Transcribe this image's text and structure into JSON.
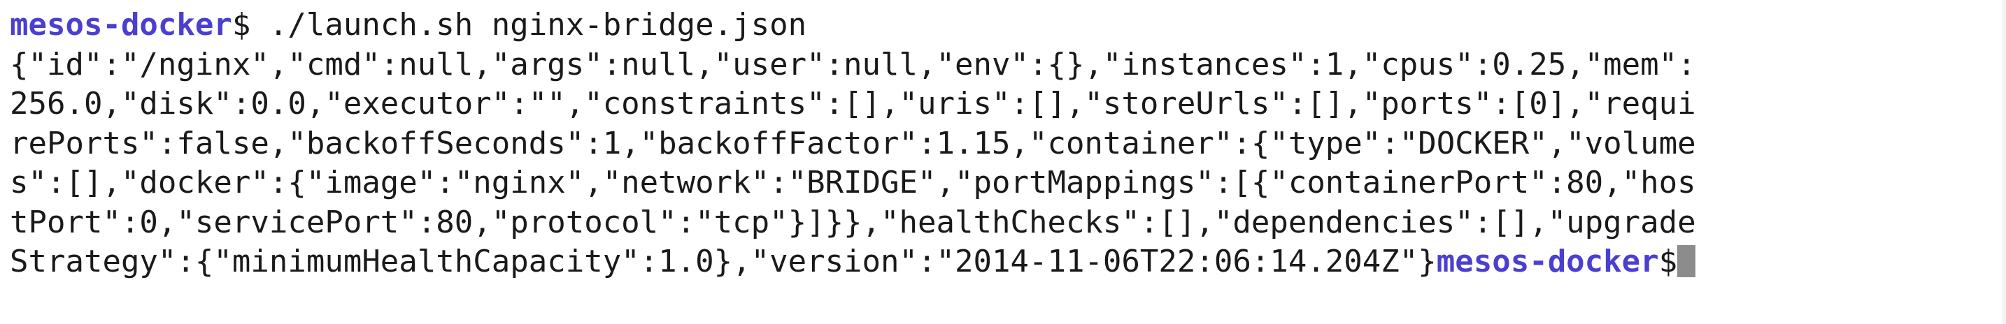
{
  "colors": {
    "prompt": "#4a3fd0",
    "text": "#1a1a1a",
    "cursor": "#8c8c8c",
    "background": "#ffffff"
  },
  "terminal": {
    "prompt_label": "mesos-docker",
    "prompt_symbol": "$",
    "command": " ./launch.sh nginx-bridge.json",
    "output_lines": [
      "{\"id\":\"/nginx\",\"cmd\":null,\"args\":null,\"user\":null,\"env\":{},\"instances\":1,\"cpus\":0.25,\"mem\":",
      "256.0,\"disk\":0.0,\"executor\":\"\",\"constraints\":[],\"uris\":[],\"storeUrls\":[],\"ports\":[0],\"requi",
      "rePorts\":false,\"backoffSeconds\":1,\"backoffFactor\":1.15,\"container\":{\"type\":\"DOCKER\",\"volume",
      "s\":[],\"docker\":{\"image\":\"nginx\",\"network\":\"BRIDGE\",\"portMappings\":[{\"containerPort\":80,\"hos",
      "tPort\":0,\"servicePort\":80,\"protocol\":\"tcp\"}]}},\"healthChecks\":[],\"dependencies\":[],\"upgrade"
    ],
    "last_output_line": "Strategy\":{\"minimumHealthCapacity\":1.0},\"version\":\"2014-11-06T22:06:14.204Z\"}",
    "trailing_prompt_label": "mesos-docker",
    "trailing_prompt_symbol": "$"
  }
}
